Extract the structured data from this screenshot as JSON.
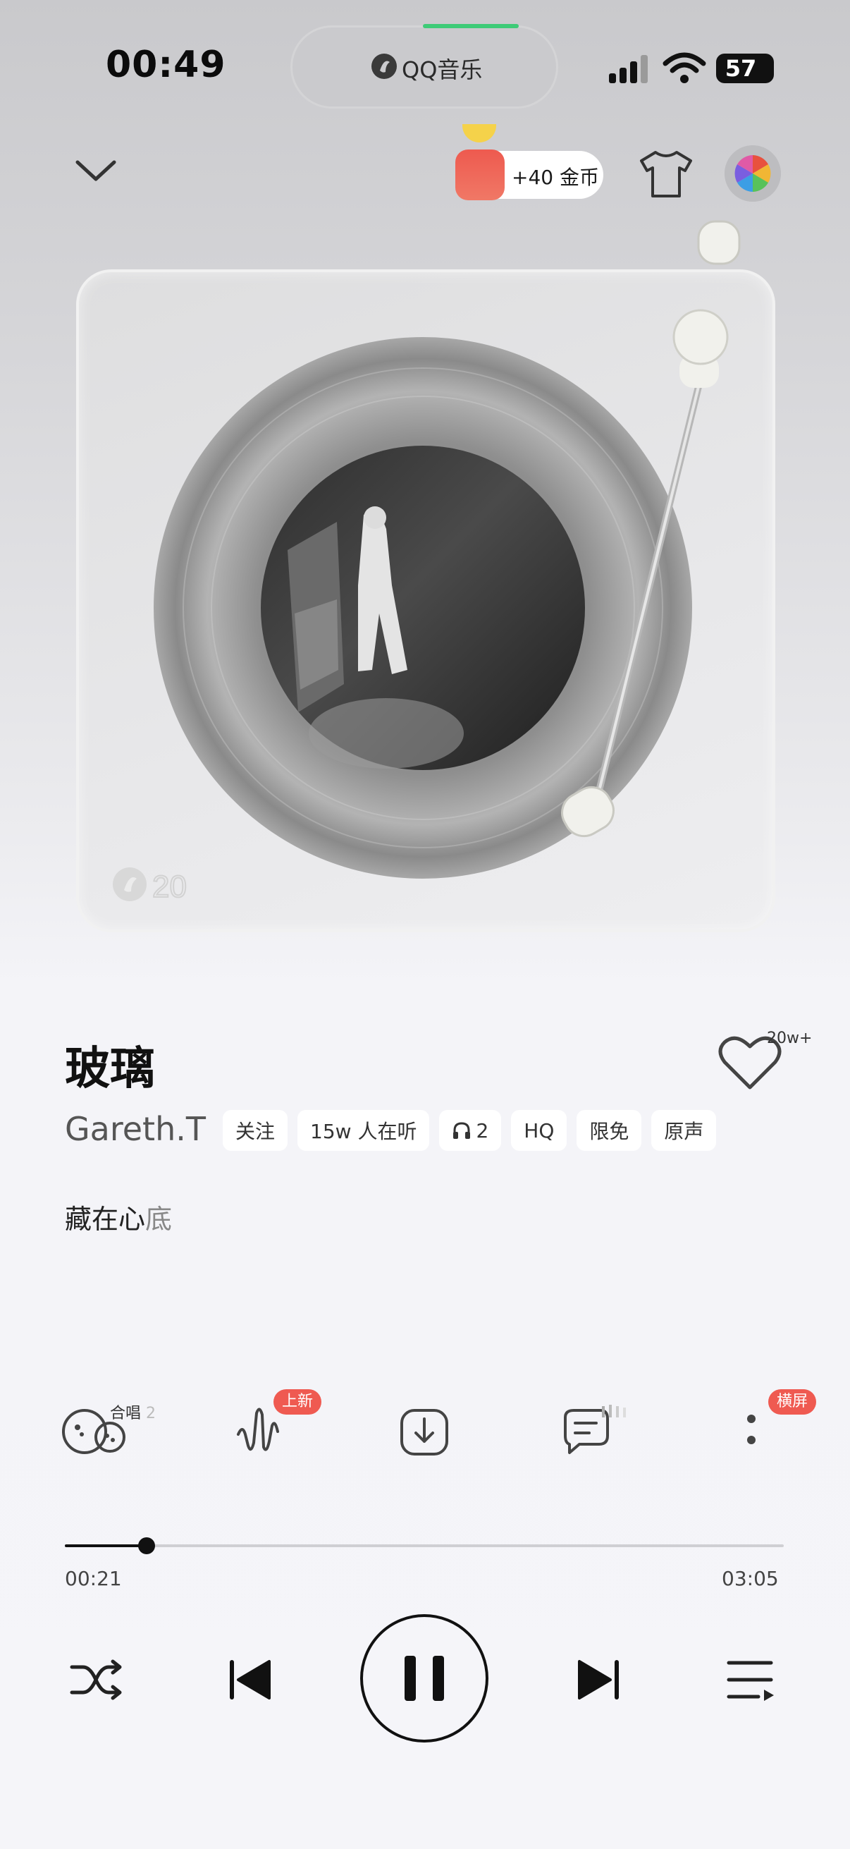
{
  "status_bar": {
    "time": "00:49",
    "island_label": "QQ音乐",
    "battery": "57"
  },
  "top_bar": {
    "coin_reward": "+40 金币"
  },
  "album": {
    "watermark": "20",
    "colors": {
      "accent_green": "#3ecb77",
      "badge_red": "#ef5a51"
    }
  },
  "song": {
    "title": "玻璃",
    "artist": "Gareth.T",
    "like_count": "20w+",
    "tags": [
      {
        "label": "关注"
      },
      {
        "label": "15w 人在听"
      },
      {
        "label": "2",
        "icon": "headphones-icon"
      },
      {
        "label": "HQ"
      },
      {
        "label": "限免"
      },
      {
        "label": "原声"
      }
    ],
    "lyric_dark": "藏在心",
    "lyric_light": "底"
  },
  "actions": {
    "chorus_label": "合唱",
    "chorus_count": "2",
    "sound_badge": "上新",
    "landscape_badge": "横屏",
    "icons": [
      "chorus-icon",
      "sound-effect-icon",
      "download-icon",
      "comment-icon",
      "more-icon"
    ]
  },
  "progress": {
    "current": "00:21",
    "total": "03:05",
    "fraction": 0.114
  },
  "controls": {
    "state": "playing",
    "icons": [
      "shuffle-icon",
      "previous-icon",
      "pause-icon",
      "next-icon",
      "playlist-icon"
    ]
  }
}
